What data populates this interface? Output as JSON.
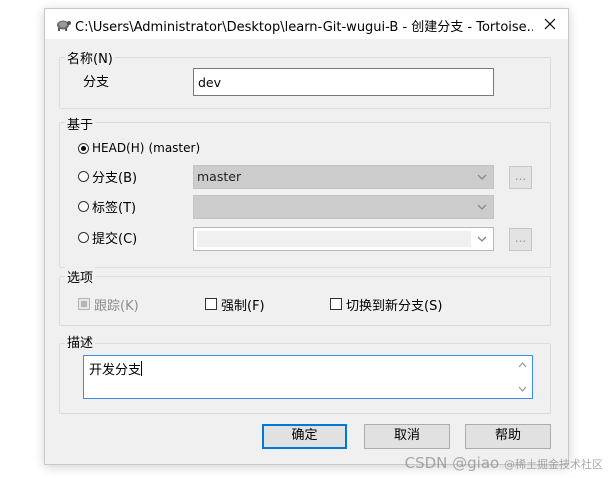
{
  "window": {
    "title": "C:\\Users\\Administrator\\Desktop\\learn-Git-wugui-B - 创建分支 - Tortoise...",
    "close_icon": "close-icon"
  },
  "name_group": {
    "title": "名称(N)",
    "branch_label": "分支",
    "branch_value": "dev"
  },
  "base_group": {
    "title": "基于",
    "head_label": "HEAD(H)",
    "head_extra": "(master)",
    "branch_label": "分支(B)",
    "branch_value": "master",
    "tag_label": "标签(T)",
    "commit_label": "提交(C)",
    "browse_label": "...",
    "selected": "head"
  },
  "options_group": {
    "title": "选项",
    "track_label": "跟踪(K)",
    "force_label": "强制(F)",
    "switch_label": "切换到新分支(S)"
  },
  "desc_group": {
    "title": "描述",
    "text": "开发分支"
  },
  "buttons": {
    "ok": "确定",
    "cancel": "取消",
    "help": "帮助"
  },
  "watermark": {
    "main": "CSDN @giao",
    "sub": "@稀土掘金技术社区"
  },
  "colors": {
    "accent": "#0078d7",
    "dialog_bg": "#f0f0f0",
    "disabled_combo": "#cccccc"
  }
}
